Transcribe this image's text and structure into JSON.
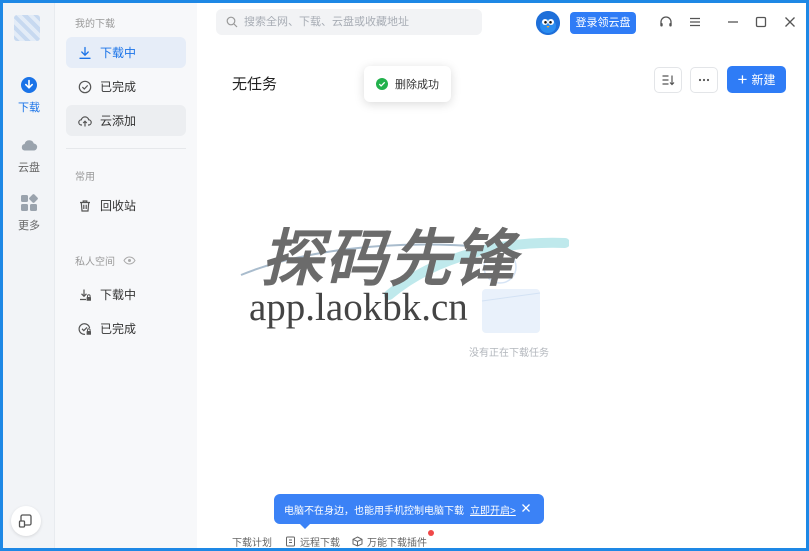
{
  "colors": {
    "accent": "#2f7cf6",
    "window_border": "#1e88e5",
    "success": "#22b14c",
    "badge_red": "#f04848"
  },
  "rail": {
    "items": [
      {
        "label": "下载",
        "icon": "download-icon",
        "active": true
      },
      {
        "label": "云盘",
        "icon": "cloud-icon",
        "active": false
      },
      {
        "label": "更多",
        "icon": "grid-icon",
        "active": false
      }
    ],
    "bottom_icon": "tablet-icon"
  },
  "nav": {
    "section_mine": "我的下载",
    "items_mine": [
      {
        "label": "下载中",
        "icon": "download-icon"
      },
      {
        "label": "已完成",
        "icon": "check-circle-icon"
      },
      {
        "label": "云添加",
        "icon": "cloud-upload-icon"
      }
    ],
    "section_common": "常用",
    "recycle": {
      "label": "回收站",
      "icon": "trash-icon"
    },
    "section_private": "私人空间",
    "private_items": [
      {
        "label": "下载中",
        "icon": "private-download-icon"
      },
      {
        "label": "已完成",
        "icon": "private-done-icon"
      }
    ]
  },
  "topbar": {
    "search_placeholder": "搜索全网、下载、云盘或收藏地址",
    "search_value": "",
    "login_button": "登录领云盘"
  },
  "content": {
    "title": "无任务",
    "toast": "删除成功",
    "new_button": "新建",
    "empty_text": "没有正在下载任务"
  },
  "watermark": {
    "title": "探码先锋",
    "url": "app.laokbk.cn"
  },
  "banner": {
    "text": "电脑不在身边，也能用手机控制电脑下载",
    "link": "立即开启>"
  },
  "footer": {
    "plan": "下载计划",
    "remote": "远程下载",
    "plugin": "万能下载插件"
  }
}
